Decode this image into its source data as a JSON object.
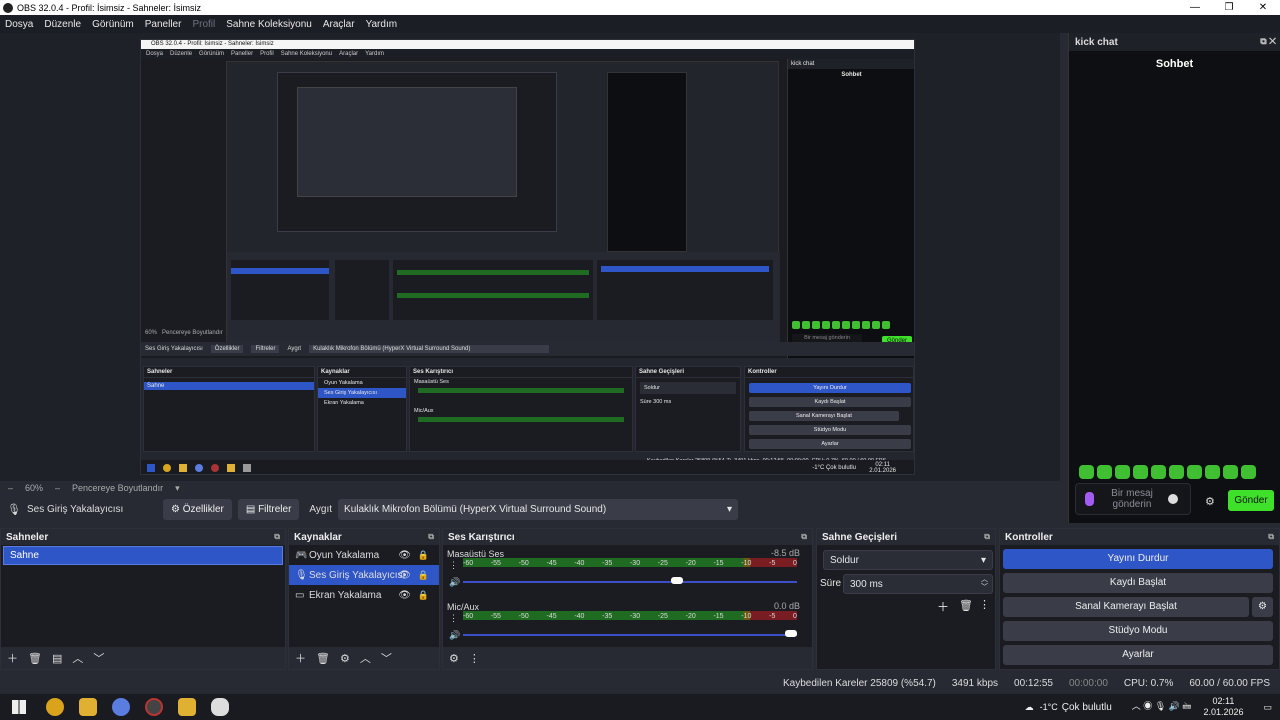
{
  "window": {
    "title": "OBS 32.0.4 - Profil: İsimsiz - Sahneler: İsimsiz",
    "controls": [
      "—",
      "❐",
      "✕"
    ]
  },
  "menu": [
    "Dosya",
    "Düzenle",
    "Görünüm",
    "Paneller",
    "Profil",
    "Sahne Koleksiyonu",
    "Araçlar",
    "Yardım"
  ],
  "preview_nested": {
    "title": "OBS 32.0.4 - Profil: İsimsiz - Sahneler: İsimsiz",
    "menu": [
      "Dosya",
      "Düzenle",
      "Görünüm",
      "Paneller",
      "Profil",
      "Sahne Koleksiyonu",
      "Araçlar",
      "Yardım"
    ],
    "chat_title": "kick chat",
    "chat_head": "Sohbet",
    "msg_placeholder": "Bir mesaj gönderin",
    "send": "Gönder",
    "zoom": "60%",
    "fit": "Pencereye Boyutlandır",
    "source": "Ses Giriş Yakalayıcısı",
    "props": "Özellikler",
    "filters": "Filtreler",
    "device_label": "Aygıt",
    "device": "Kulaklık Mikrofon Bölümü (HyperX Virtual Surround Sound)",
    "scenes_h": "Sahneler",
    "scene": "Sahne",
    "sources_h": "Kaynaklar",
    "mixer_h": "Ses Karıştırıcı",
    "trans_h": "Sahne Geçişleri",
    "ctl_h": "Kontroller",
    "src": [
      "Oyun Yakalama",
      "Ses Giriş Yakalayıcısı",
      "Ekran Yakalama"
    ],
    "ch1": "Masaüstü Ses",
    "ch1db": "-8.5 dB",
    "ch2": "Mic/Aux",
    "ch2db": "0.0 dB",
    "trans": "Soldur",
    "dur_label": "Süre",
    "dur": "300 ms",
    "ctl": [
      "Yayını Durdur",
      "Kaydı Başlat",
      "Sanal Kamerayı Başlat",
      "Stüdyo Modu",
      "Ayarlar"
    ],
    "status": "Kaybedilen Kareler 25809 (%54.7)",
    "kbps": "3491 kbps",
    "time": "00:12:55",
    "rec": "00:00:00",
    "cpu": "CPU: 0.7%",
    "fps": "60.00 / 60.00 FPS",
    "weather": "-1°C",
    "weather_txt": "Çok bulutlu",
    "clock": "02:11",
    "date": "2.01.2026"
  },
  "zoom": {
    "level": "60%",
    "fit": "Pencereye Boyutlandır"
  },
  "chat": {
    "title": "kick chat",
    "header": "Sohbet",
    "placeholder": "Bir mesaj gönderin",
    "send": "Gönder"
  },
  "source_toolbar": {
    "name": "Ses Giriş Yakalayıcısı",
    "properties": "Özellikler",
    "filters": "Filtreler",
    "device_label": "Aygıt",
    "device": "Kulaklık Mikrofon Bölümü (HyperX Virtual Surround Sound)"
  },
  "scenes": {
    "title": "Sahneler",
    "items": [
      "Sahne"
    ]
  },
  "sources": {
    "title": "Kaynaklar",
    "items": [
      "Oyun Yakalama",
      "Ses Giriş Yakalayıcısı",
      "Ekran Yakalama"
    ]
  },
  "mixer": {
    "title": "Ses Karıştırıcı",
    "ticks": [
      "-60",
      "-55",
      "-50",
      "-45",
      "-40",
      "-35",
      "-30",
      "-25",
      "-20",
      "-15",
      "-10",
      "-5",
      "0"
    ],
    "ch1": {
      "name": "Masaüstü Ses",
      "db": "-8.5 dB",
      "level": 0.66
    },
    "ch2": {
      "name": "Mic/Aux",
      "db": "0.0 dB",
      "level": 1.0
    }
  },
  "transitions": {
    "title": "Sahne Geçişleri",
    "selected": "Soldur",
    "duration_label": "Süre",
    "duration": "300 ms"
  },
  "controls": {
    "title": "Kontroller",
    "buttons": [
      "Yayını Durdur",
      "Kaydı Başlat",
      "Sanal Kamerayı Başlat",
      "Stüdyo Modu",
      "Ayarlar"
    ]
  },
  "status": {
    "dropped": "Kaybedilen Kareler 25809 (%54.7)",
    "bitrate": "3491 kbps",
    "stream_time": "00:12:55",
    "rec_time": "00:00:00",
    "cpu": "CPU: 0.7%",
    "fps": "60.00 / 60.00 FPS"
  },
  "taskbar": {
    "weather_temp": "-1°C",
    "weather_text": "Çok bulutlu",
    "time": "02:11",
    "date": "2.01.2026"
  },
  "colors": {
    "accent": "#2f56c7",
    "kick_green": "#3fe02a",
    "bg": "#272a33"
  }
}
